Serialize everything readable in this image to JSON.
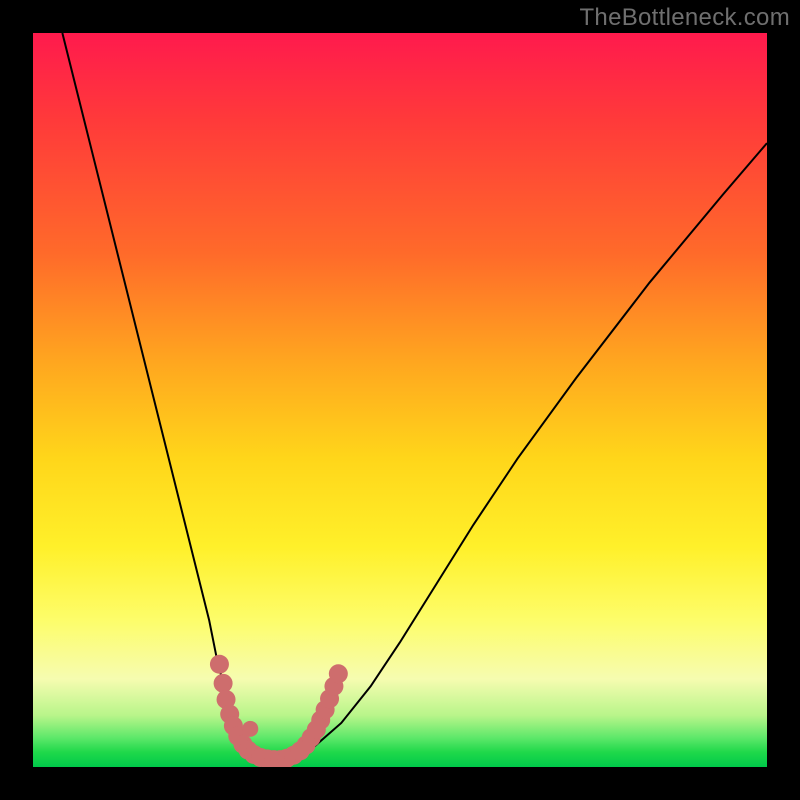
{
  "watermark": "TheBottleneck.com",
  "chart_data": {
    "type": "line",
    "title": "",
    "xlabel": "",
    "ylabel": "",
    "xlim": [
      0,
      100
    ],
    "ylim": [
      0,
      100
    ],
    "series": [
      {
        "name": "bottleneck-curve",
        "x": [
          4,
          6,
          8,
          10,
          12,
          14,
          16,
          18,
          20,
          22,
          24,
          25,
          26,
          27,
          28,
          29,
          30,
          31,
          32,
          33.5,
          35,
          38,
          42,
          46,
          50,
          55,
          60,
          66,
          74,
          84,
          94,
          100
        ],
        "values": [
          100,
          92,
          84,
          76,
          68,
          60,
          52,
          44,
          36,
          28,
          20,
          15,
          11,
          7.5,
          5,
          3.3,
          2.3,
          1.6,
          1.3,
          1.0,
          1.2,
          2.5,
          6,
          11,
          17,
          25,
          33,
          42,
          53,
          66,
          78,
          85
        ]
      }
    ],
    "highlight": {
      "name": "trough-dots",
      "points": [
        {
          "x": 25.4,
          "y": 14.0
        },
        {
          "x": 25.9,
          "y": 11.4
        },
        {
          "x": 26.3,
          "y": 9.2
        },
        {
          "x": 26.8,
          "y": 7.2
        },
        {
          "x": 27.3,
          "y": 5.6
        },
        {
          "x": 27.9,
          "y": 4.2
        },
        {
          "x": 28.6,
          "y": 3.1
        },
        {
          "x": 29.3,
          "y": 2.3
        },
        {
          "x": 30.1,
          "y": 1.7
        },
        {
          "x": 31.0,
          "y": 1.3
        },
        {
          "x": 31.9,
          "y": 1.1
        },
        {
          "x": 32.8,
          "y": 1.0
        },
        {
          "x": 33.7,
          "y": 1.0
        },
        {
          "x": 34.6,
          "y": 1.2
        },
        {
          "x": 35.5,
          "y": 1.6
        },
        {
          "x": 36.4,
          "y": 2.2
        },
        {
          "x": 37.2,
          "y": 3.0
        },
        {
          "x": 37.9,
          "y": 4.0
        },
        {
          "x": 38.6,
          "y": 5.1
        },
        {
          "x": 39.2,
          "y": 6.4
        },
        {
          "x": 39.8,
          "y": 7.8
        },
        {
          "x": 40.4,
          "y": 9.3
        },
        {
          "x": 41.0,
          "y": 11.0
        },
        {
          "x": 41.6,
          "y": 12.7
        }
      ]
    },
    "extra_points": [
      {
        "x": 29.6,
        "y": 5.2
      }
    ],
    "colors": {
      "curve": "#000000",
      "dots": "#ce6d6d"
    }
  }
}
